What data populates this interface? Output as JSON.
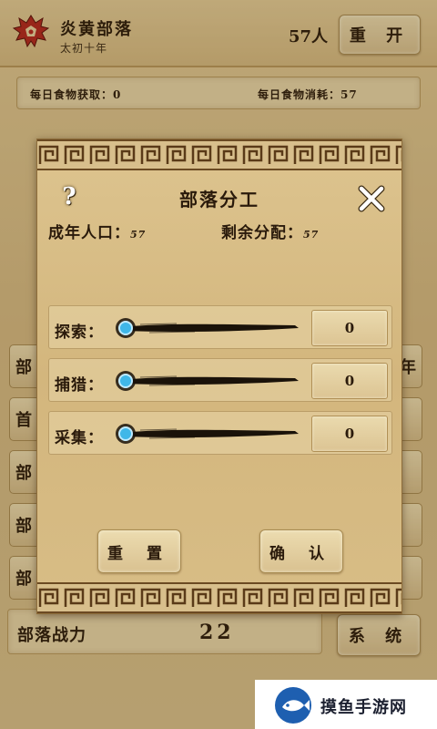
{
  "header": {
    "tribe_name": "炎黄部落",
    "era": "太初十年",
    "population": "57人",
    "restart_label": "重 开"
  },
  "food": {
    "gain": "每日食物获取：0",
    "consume": "每日食物消耗：57"
  },
  "background_buttons": {
    "left": [
      "部",
      "首",
      "部",
      "部",
      "部"
    ],
    "right": [
      "年",
      "",
      "",
      "",
      ""
    ]
  },
  "bottom": {
    "power_label": "部落战力",
    "power_value": "22",
    "system_label": "系 统"
  },
  "dialog": {
    "title": "部落分工",
    "help_icon": "?",
    "adult_label": "成年人口",
    "adult_value": "57",
    "remaining_label": "剩余分配",
    "remaining_value": "57",
    "jobs": [
      {
        "label": "探索：",
        "value": "0",
        "fraction": 0
      },
      {
        "label": "捕猎：",
        "value": "0",
        "fraction": 0
      },
      {
        "label": "采集：",
        "value": "0",
        "fraction": 0
      }
    ],
    "reset_label": "重 置",
    "confirm_label": "确 认"
  },
  "watermark": {
    "text": "摸鱼手游网"
  },
  "colors": {
    "parchment": "#d9c08c",
    "ink": "#2a1a0b",
    "slider_knob": "#3fb7e8",
    "emblem_red": "#b3261e"
  },
  "icons": {
    "emblem": "horde-emblem-icon",
    "help": "question-mark-icon",
    "close": "close-icon",
    "slider": "ink-brush-slider",
    "watermark": "fish-logo-icon"
  }
}
